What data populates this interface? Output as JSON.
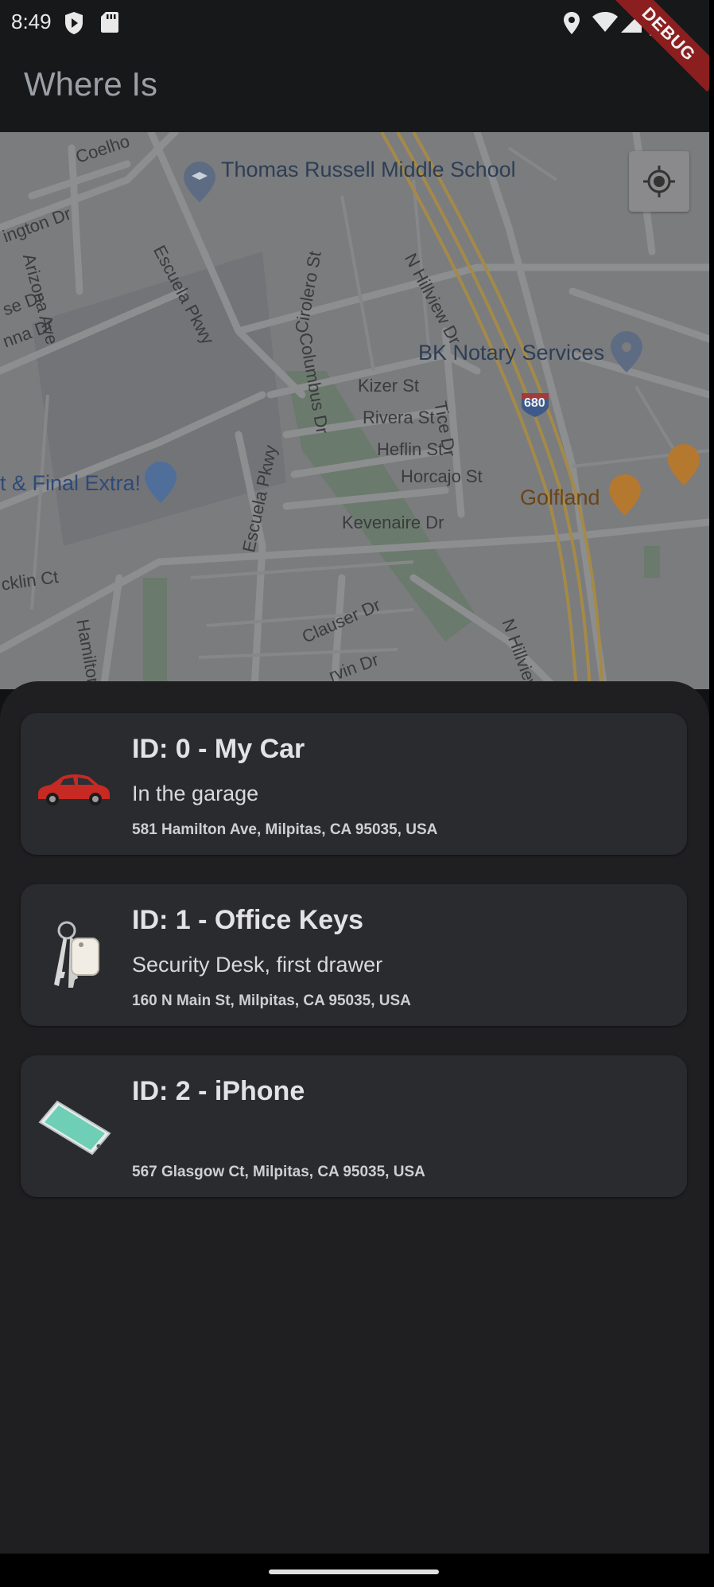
{
  "status_bar": {
    "time": "8:49"
  },
  "app_bar": {
    "title": "Where Is",
    "debug_banner": "DEBUG"
  },
  "map": {
    "labels": {
      "school": "Thomas Russell Middle School",
      "notary": "BK Notary Services",
      "store": "t & Final Extra!",
      "golf": "Golfland",
      "hwy": "680",
      "escuela1": "Escuela Pkwy",
      "escuela2": "Escuela Pkwy",
      "columbus": "Columbus Dr",
      "kizer": "Kizer St",
      "rivera": "Rivera St",
      "heflin": "Heflin St",
      "horcajo": "Horcajo St",
      "tice": "Tice Dr",
      "hillview1": "N Hillview Dr",
      "hillview2": "N Hillview",
      "kevenaire": "Kevenaire Dr",
      "clauser": "Clauser Dr",
      "arvin": "rvin Dr",
      "cirolero": "Cirolero St",
      "arizona": "Arizona Ave",
      "hamilton": "Hamilton",
      "ington": "ington Dr",
      "coelho": "Coelho",
      "ecklin": "cklin Ct",
      "nna": "nna Dr",
      "se": "se Dr"
    }
  },
  "items": [
    {
      "title": "ID: 0 - My Car",
      "note": "In the garage",
      "address": "581 Hamilton Ave, Milpitas, CA 95035, USA",
      "icon": "car-icon"
    },
    {
      "title": "ID: 1 - Office Keys",
      "note": "Security Desk, first drawer",
      "address": "160 N Main St, Milpitas, CA 95035, USA",
      "icon": "keys-icon"
    },
    {
      "title": "ID: 2 - iPhone",
      "note": "",
      "address": "567 Glasgow Ct, Milpitas, CA 95035, USA",
      "icon": "phone-icon"
    }
  ]
}
